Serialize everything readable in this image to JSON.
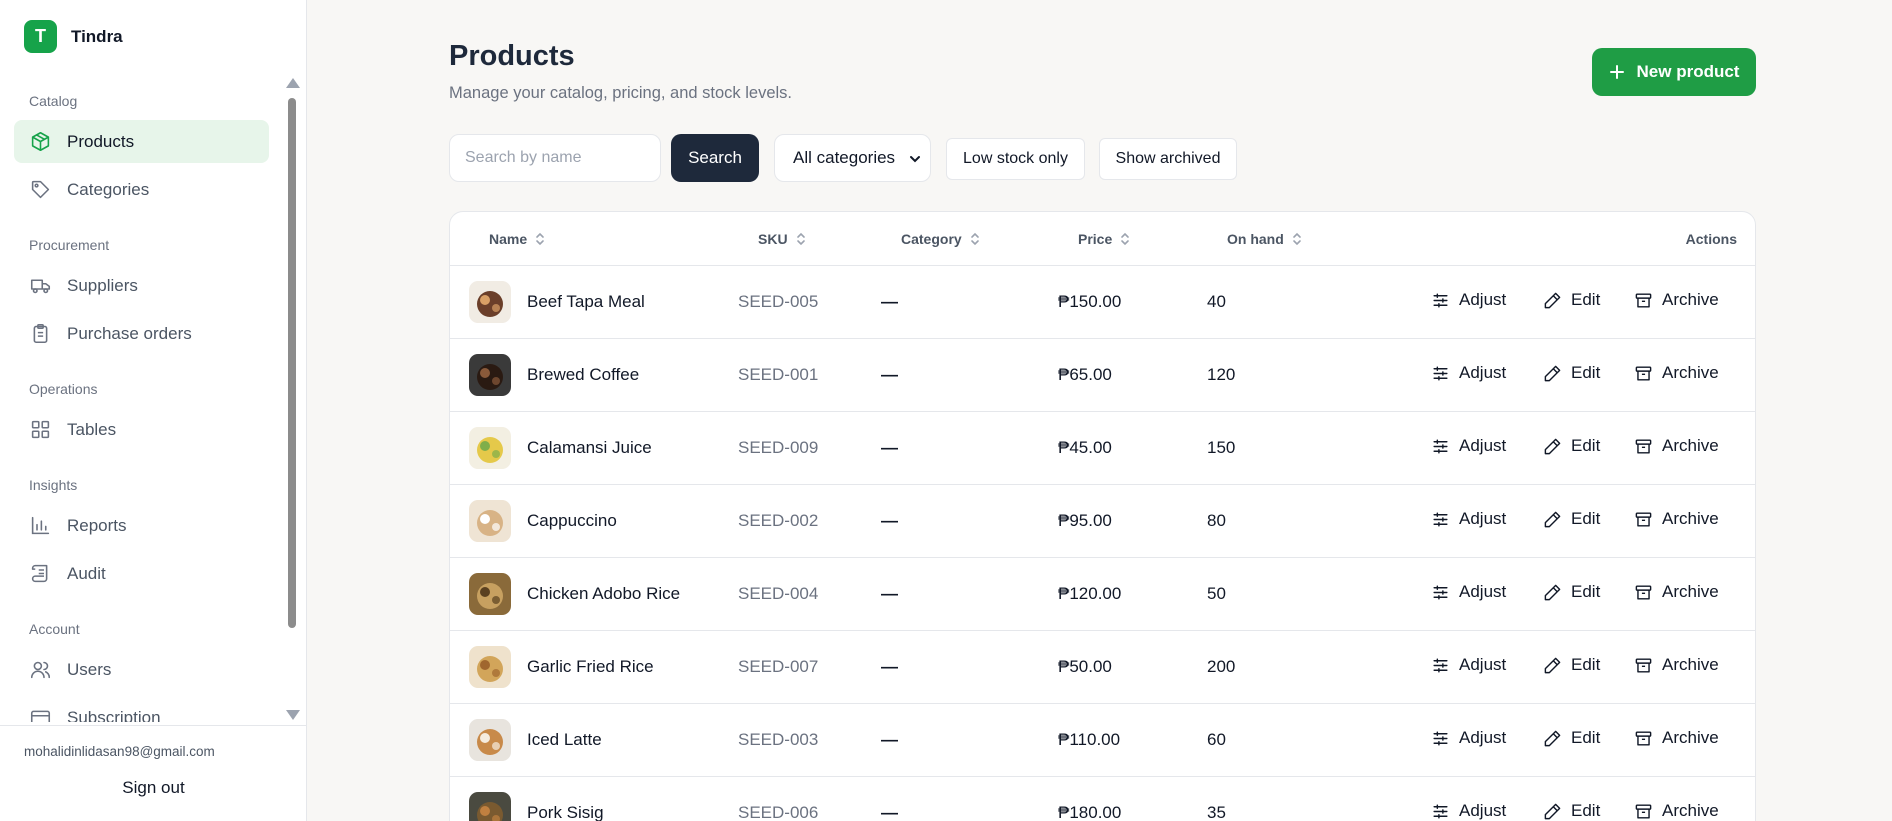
{
  "brand": {
    "initial": "T",
    "name": "Tindra"
  },
  "sidebar": {
    "sections": [
      {
        "title": "Catalog",
        "items": [
          {
            "label": "Products",
            "icon": "box-icon",
            "active": true
          },
          {
            "label": "Categories",
            "icon": "tag-icon"
          }
        ]
      },
      {
        "title": "Procurement",
        "items": [
          {
            "label": "Suppliers",
            "icon": "truck-icon"
          },
          {
            "label": "Purchase orders",
            "icon": "clipboard-icon"
          }
        ]
      },
      {
        "title": "Operations",
        "items": [
          {
            "label": "Tables",
            "icon": "grid-icon"
          }
        ]
      },
      {
        "title": "Insights",
        "items": [
          {
            "label": "Reports",
            "icon": "bar-chart-icon"
          },
          {
            "label": "Audit",
            "icon": "scroll-icon"
          }
        ]
      },
      {
        "title": "Account",
        "items": [
          {
            "label": "Users",
            "icon": "users-icon"
          },
          {
            "label": "Subscription",
            "icon": "credit-card-icon"
          }
        ]
      }
    ],
    "user_email": "mohalidinlidasan98@gmail.com",
    "sign_out": "Sign out"
  },
  "header": {
    "title": "Products",
    "subtitle": "Manage your catalog, pricing, and stock levels.",
    "new_button": "New product"
  },
  "filters": {
    "search_placeholder": "Search by name",
    "search_value": "",
    "search_button": "Search",
    "category_select": "All categories",
    "low_stock": "Low stock only",
    "show_archived": "Show archived"
  },
  "table": {
    "columns": {
      "name": "Name",
      "sku": "SKU",
      "category": "Category",
      "price": "Price",
      "on_hand": "On hand",
      "actions": "Actions"
    },
    "action_labels": {
      "adjust": "Adjust",
      "edit": "Edit",
      "archive": "Archive"
    },
    "rows": [
      {
        "name": "Beef Tapa Meal",
        "sku": "SEED-005",
        "category": "—",
        "price": "₱150.00",
        "on_hand": "40"
      },
      {
        "name": "Brewed Coffee",
        "sku": "SEED-001",
        "category": "—",
        "price": "₱65.00",
        "on_hand": "120"
      },
      {
        "name": "Calamansi Juice",
        "sku": "SEED-009",
        "category": "—",
        "price": "₱45.00",
        "on_hand": "150"
      },
      {
        "name": "Cappuccino",
        "sku": "SEED-002",
        "category": "—",
        "price": "₱95.00",
        "on_hand": "80"
      },
      {
        "name": "Chicken Adobo Rice",
        "sku": "SEED-004",
        "category": "—",
        "price": "₱120.00",
        "on_hand": "50"
      },
      {
        "name": "Garlic Fried Rice",
        "sku": "SEED-007",
        "category": "—",
        "price": "₱50.00",
        "on_hand": "200"
      },
      {
        "name": "Iced Latte",
        "sku": "SEED-003",
        "category": "—",
        "price": "₱110.00",
        "on_hand": "60"
      },
      {
        "name": "Pork Sisig",
        "sku": "SEED-006",
        "category": "—",
        "price": "₱180.00",
        "on_hand": "35"
      }
    ]
  },
  "colors": {
    "accent": "#16a34a",
    "primary_dark": "#1e293b",
    "active_nav_bg": "#e7f5ea"
  }
}
